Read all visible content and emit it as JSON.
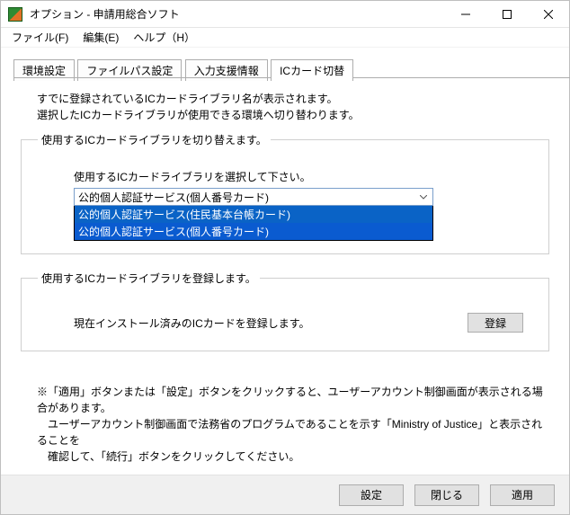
{
  "window": {
    "title": "オプション - 申請用総合ソフト"
  },
  "menu": {
    "file": "ファイル(F)",
    "edit": "編集(E)",
    "help": "ヘルプ（H）"
  },
  "tabs": {
    "t1": "環境設定",
    "t2": "ファイルパス設定",
    "t3": "入力支援情報",
    "t4": "ICカード切替"
  },
  "intro": {
    "l1": "すでに登録されているICカードライブラリ名が表示されます。",
    "l2": "選択したICカードライブラリが使用できる環境へ切り替わります。"
  },
  "group1": {
    "legend": "使用するICカードライブラリを切り替えます。",
    "selectLabel": "使用するICカードライブラリを選択して下さい。",
    "selected": "公的個人認証サービス(個人番号カード)",
    "opt1": "公的個人認証サービス(住民基本台帳カード)",
    "opt2": "公的個人認証サービス(個人番号カード)"
  },
  "group2": {
    "legend": "使用するICカードライブラリを登録します。",
    "text": "現在インストール済みのICカードを登録します。",
    "button": "登録"
  },
  "note": {
    "l1": "※「適用」ボタンまたは「設定」ボタンをクリックすると、ユーザーアカウント制御画面が表示される場合があります。",
    "l2": "　ユーザーアカウント制御画面で法務省のプログラムであることを示す「Ministry of Justice」と表示されることを",
    "l3": "　確認して、「続行」ボタンをクリックしてください。"
  },
  "footer": {
    "settings": "設定",
    "close": "閉じる",
    "apply": "適用"
  }
}
